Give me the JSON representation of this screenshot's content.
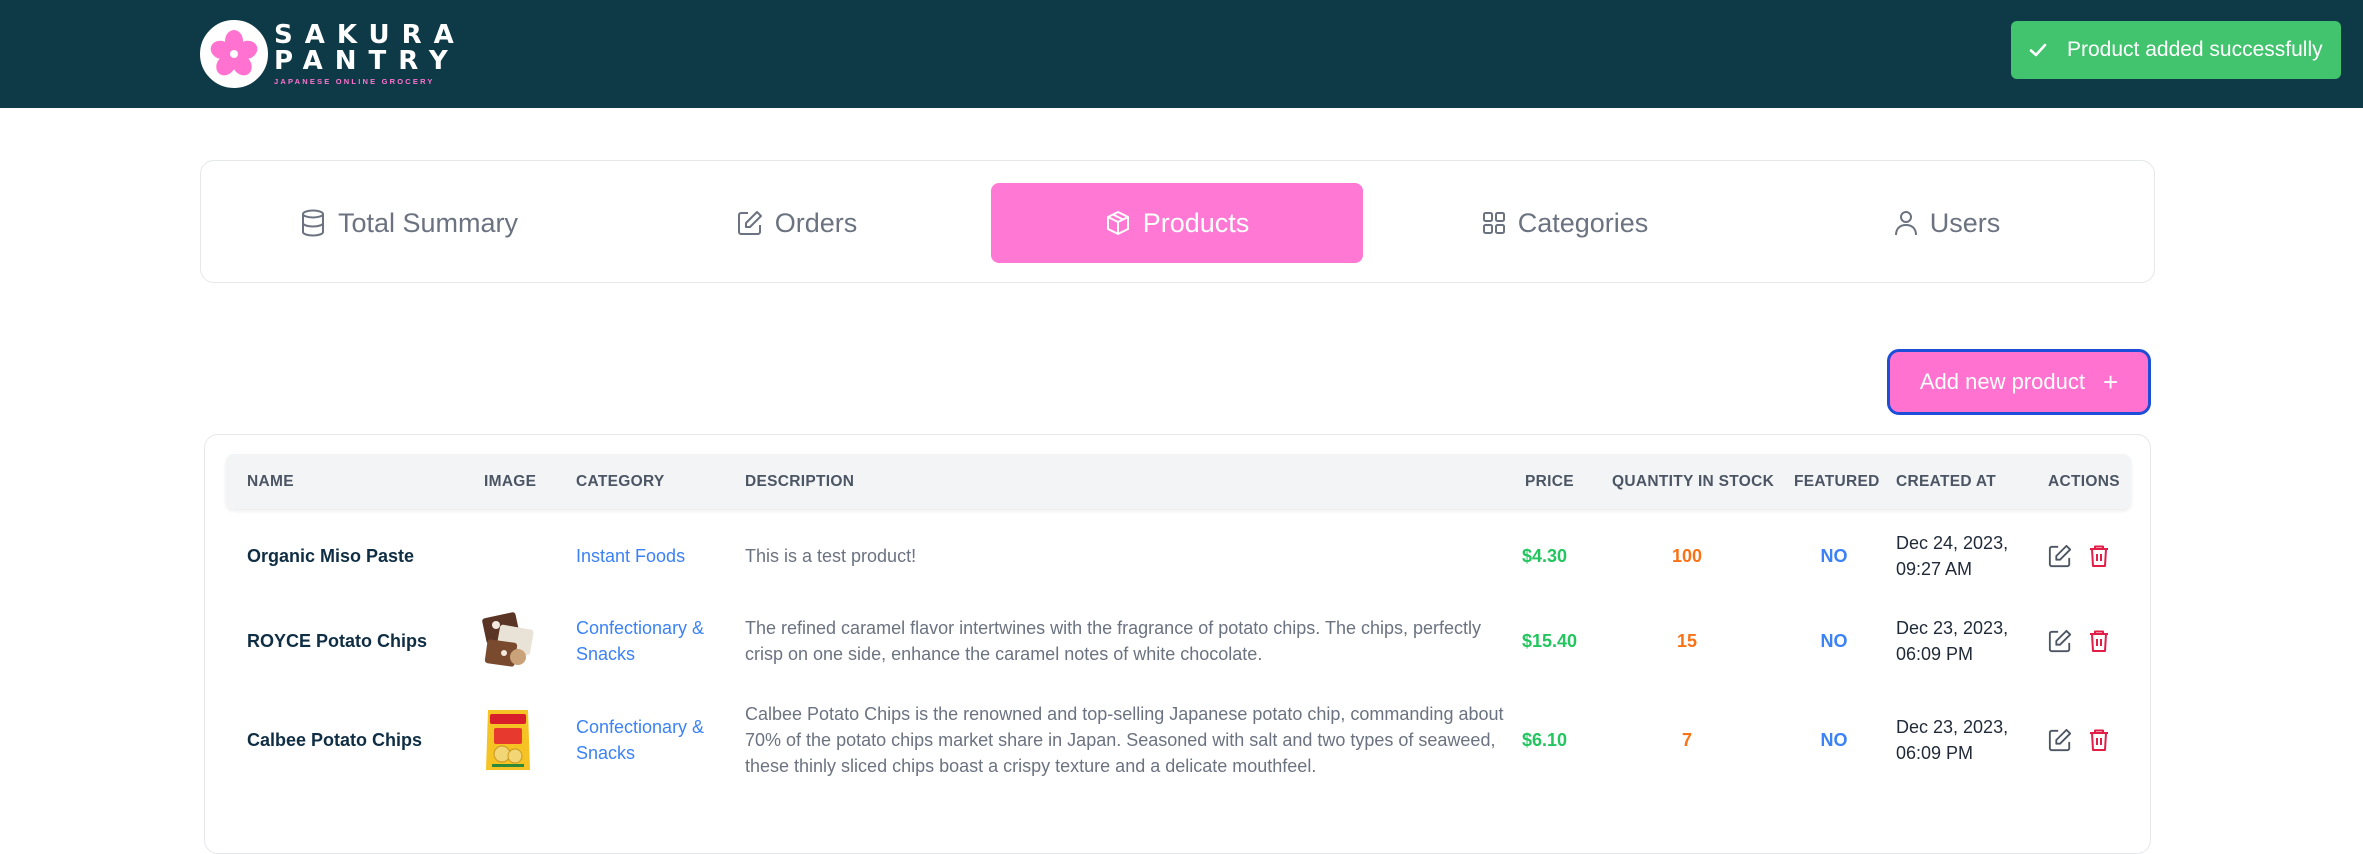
{
  "header": {
    "brand_line1": "SAKURA",
    "brand_line2": "PANTRY",
    "brand_tagline": "JAPANESE ONLINE GROCERY",
    "brand_color": "#0e3a47",
    "accent_color": "#ff72d0"
  },
  "toast": {
    "icon": "check-icon",
    "message": "Product added successfully",
    "color": "#41c46d"
  },
  "tabs": [
    {
      "label": "Total Summary",
      "icon": "database-icon",
      "active": false
    },
    {
      "label": "Orders",
      "icon": "edit-icon",
      "active": false
    },
    {
      "label": "Products",
      "icon": "box-icon",
      "active": true
    },
    {
      "label": "Categories",
      "icon": "grid-icon",
      "active": false
    },
    {
      "label": "Users",
      "icon": "user-icon",
      "active": false
    }
  ],
  "add_button": {
    "label": "Add new product",
    "icon": "plus-icon",
    "symbol": "+"
  },
  "table": {
    "columns": [
      "NAME",
      "IMAGE",
      "CATEGORY",
      "DESCRIPTION",
      "PRICE",
      "QUANTITY IN STOCK",
      "FEATURED",
      "CREATED AT",
      "ACTIONS"
    ],
    "rows": [
      {
        "name": "Organic Miso Paste",
        "image": "",
        "category": "Instant Foods",
        "description": "This is a test product!",
        "price": "$4.30",
        "quantity": "100",
        "featured": "NO",
        "created_date": "Dec 24, 2023,",
        "created_time": "09:27 AM"
      },
      {
        "name": "ROYCE Potato Chips",
        "image": "royce-chips-thumbnail",
        "category": "Confectionary & Snacks",
        "description": "The refined caramel flavor intertwines with the fragrance of potato chips. The chips, perfectly crisp on one side, enhance the caramel notes of white chocolate.",
        "price": "$15.40",
        "quantity": "15",
        "featured": "NO",
        "created_date": "Dec 23, 2023,",
        "created_time": "06:09 PM"
      },
      {
        "name": "Calbee Potato Chips",
        "image": "calbee-chips-thumbnail",
        "category": "Confectionary & Snacks",
        "description": "Calbee Potato Chips is the renowned and top-selling Japanese potato chip, commanding about 70% of the potato chips market share in Japan. Seasoned with salt and two types of seaweed, these thinly sliced chips boast a crispy texture and a delicate mouthfeel.",
        "price": "$6.10",
        "quantity": "7",
        "featured": "NO",
        "created_date": "Dec 23, 2023,",
        "created_time": "06:09 PM"
      }
    ]
  }
}
